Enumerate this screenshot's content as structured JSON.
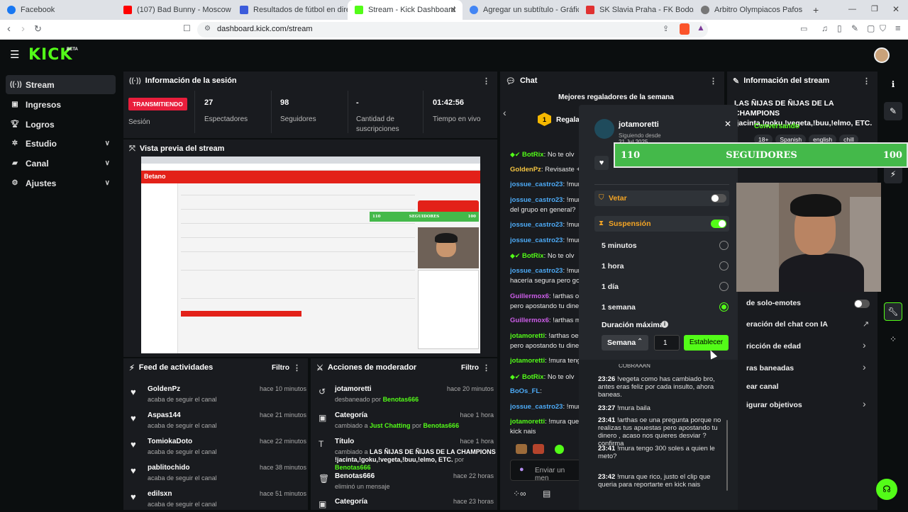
{
  "browser": {
    "tabs": [
      {
        "label": "Facebook",
        "color": "#1877f2"
      },
      {
        "label": "(107) Bad Bunny - Moscow Mule",
        "color": "#ff0000"
      },
      {
        "label": "Resultados de fútbol en directo, calen",
        "color": "#3b5bdb"
      },
      {
        "label": "Stream - Kick Dashboard",
        "color": "#53fc18"
      },
      {
        "label": "Agregar un subtítulo - Gráfico",
        "color": "#4285f4"
      },
      {
        "label": "SK Slavia Praha - FK Bodo/Glimt Fútb",
        "color": "#e03131"
      },
      {
        "label": "Arbitro Olympiacos Pafos",
        "color": "#777"
      }
    ],
    "url": "dashboard.kick.com/stream"
  },
  "app": {
    "logo": "KICK",
    "logo_badge": "BETA"
  },
  "sidebar": {
    "items": [
      {
        "label": "Stream",
        "icon": "broadcast-icon"
      },
      {
        "label": "Ingresos",
        "icon": "income-icon"
      },
      {
        "label": "Logros",
        "icon": "trophy-icon"
      },
      {
        "label": "Estudio",
        "icon": "studio-icon"
      },
      {
        "label": "Canal",
        "icon": "channel-icon"
      },
      {
        "label": "Ajustes",
        "icon": "gear-icon"
      }
    ]
  },
  "session": {
    "title": "Información de la sesión",
    "live_badge": "TRANSMITIENDO",
    "session_label": "Sesión",
    "viewers": {
      "value": "27",
      "label": "Espectadores"
    },
    "followers": {
      "value": "98",
      "label": "Seguidores"
    },
    "subs": {
      "value": "-",
      "label": "Cantidad de suscripciones"
    },
    "uptime": {
      "value": "01:42:56",
      "label": "Tiempo en vivo"
    }
  },
  "preview": {
    "title": "Vista previa del stream",
    "bar_left": "110",
    "bar_label": "SEGUIDORES",
    "bar_right": "100"
  },
  "feed": {
    "title": "Feed de actividades",
    "filter": "Filtro",
    "items": [
      {
        "name": "GoldenPz",
        "sub": "acaba de seguir el canal",
        "time": "hace 10 minutos"
      },
      {
        "name": "Aspas144",
        "sub": "acaba de seguir el canal",
        "time": "hace 21 minutos"
      },
      {
        "name": "TomiokaDoto",
        "sub": "acaba de seguir el canal",
        "time": "hace 22 minutos"
      },
      {
        "name": "pablitochido",
        "sub": "acaba de seguir el canal",
        "time": "hace 38 minutos"
      },
      {
        "name": "edilsxn",
        "sub": "acaba de seguir el canal",
        "time": "hace 51 minutos"
      }
    ]
  },
  "mod": {
    "title": "Acciones de moderador",
    "filter": "Filtro",
    "items": [
      {
        "name": "jotamoretti",
        "sub_a": "desbaneado por ",
        "sub_b": "Benotas666",
        "time": "hace 20 minutos"
      },
      {
        "name": "Categoría",
        "sub_a": "cambiado a ",
        "sub_b": "Just Chatting",
        "sub_c": " por ",
        "sub_d": "Benotas666",
        "time": "hace 1 hora"
      },
      {
        "name": "Título",
        "sub_a": "cambiado a ",
        "sub_b": "LAS ÑIJAS DE ÑIJAS DE LA CHAMPIONS !jacinta,!goku,!vegeta,!buu,!elmo, ETC.",
        "sub_c": " por ",
        "sub_d": "Benotas666",
        "time": "hace 1 hora"
      },
      {
        "name": "Benotas666",
        "sub_a": "eliminó un mensaje",
        "time": "hace 22 horas"
      },
      {
        "name": "Categoría",
        "time": "hace 23 horas"
      }
    ]
  },
  "chat": {
    "title": "Chat",
    "top_gifters": "Mejores regaladores de la semana",
    "gift_label": "Regala",
    "gift_rank": "1",
    "input_placeholder": "Enviar un men",
    "lines": [
      {
        "user": "BotRix",
        "text": ": No te olv",
        "color": "#53fc18"
      },
      {
        "user": "GoldenPz",
        "text": ": Revisaste +2",
        "color": "#f5c542"
      },
      {
        "user": "jossue_castro23",
        "text": ": !mura",
        "color": "#4dabf7"
      },
      {
        "user": "jossue_castro23",
        "text": ": !mura",
        "color": "#4dabf7"
      },
      {
        "user": "",
        "text": "del grupo en general?",
        "color": "#fff"
      },
      {
        "user": "jossue_castro23",
        "text": ": !mura",
        "color": "#4dabf7"
      },
      {
        "user": "jossue_castro23",
        "text": ": !mura",
        "color": "#4dabf7"
      },
      {
        "user": "BotRix",
        "text": ": No te olv",
        "color": "#53fc18"
      },
      {
        "user": "jossue_castro23",
        "text": ": !mura",
        "color": "#4dabf7"
      },
      {
        "user": "",
        "text": "hacería segura pero gor",
        "color": "#fff"
      },
      {
        "user": "Guillermox6",
        "text": ": !arthas oe",
        "color": "#cc5de8"
      },
      {
        "user": "",
        "text": "pero apostando tu diner",
        "color": "#fff"
      },
      {
        "user": "Guillermox6",
        "text": ": !arthas mm",
        "color": "#cc5de8"
      },
      {
        "user": "jotamoretti",
        "text": ": !arthas oe",
        "color": "#53fc18"
      },
      {
        "user": "",
        "text": "pero apostando tu diner",
        "color": "#fff"
      },
      {
        "user": "jotamoretti",
        "text": ": !mura tengo",
        "color": "#53fc18"
      },
      {
        "user": "BotRix",
        "text": ": No te olv",
        "color": "#53fc18"
      },
      {
        "user": "BoOs_FL",
        "text": ":",
        "color": "#4dabf7"
      },
      {
        "user": "jossue_castro23",
        "text": ": !mura",
        "color": "#4dabf7"
      },
      {
        "user": "jotamoretti",
        "text": ": !mura que r",
        "color": "#53fc18"
      },
      {
        "user": "",
        "text": "kick nais",
        "color": "#fff"
      }
    ]
  },
  "user_card": {
    "username": "jotamoretti",
    "following_since": "Siguiendo desde",
    "date": "21 Jul 2025",
    "follow_bar_left": "110",
    "follow_bar_label": "SEGUIDORES",
    "follow_bar_right": "100",
    "vetar": "Vetar",
    "suspension": "Suspensión",
    "options": [
      "5 minutos",
      "1 hora",
      "1 día",
      "1 semana"
    ],
    "selected": "1 semana",
    "max_duration": "Duración máxima",
    "unit": "Semana",
    "amount": "1",
    "set_button": "Establecer",
    "chat_header": "COBRAAAN",
    "messages": [
      {
        "time": "23:26",
        "text": " !vegeta como has cambiado bro, antes eras feliz por cada insulto, ahora baneas."
      },
      {
        "time": "23:27",
        "text": " !mura baila"
      },
      {
        "time": "23:41",
        "text": " !arthas oe una pregunta porque no realizas tus apuestas pero apostando tu dinero , acaso nos quieres desviar ? confirma"
      },
      {
        "time": "23:41",
        "text": " !mura tengo 300 soles a quien le meto?"
      },
      {
        "time": "23:42",
        "text": " !mura que rico, justo el clip que queria para reportarte en kick nais"
      }
    ]
  },
  "stream_info": {
    "title": "Información del stream",
    "stream_title": "LAS ÑIJAS DE ÑIJAS DE LA CHAMPIONS !jacinta,!goku,!vegeta,!buu,!elmo, ETC.",
    "category": "Conversando",
    "tags": [
      "18+",
      "Spanish",
      "english",
      "chill"
    ],
    "settings": [
      {
        "label": "de solo-emotes",
        "type": "toggle"
      },
      {
        "label": "eración del chat con IA",
        "type": "external"
      },
      {
        "label": "ricción de edad",
        "type": "arrow"
      },
      {
        "label": "ras baneadas",
        "type": "arrow"
      },
      {
        "label": "ear canal",
        "type": "none"
      },
      {
        "label": "igurar objetivos",
        "type": "arrow"
      }
    ]
  }
}
